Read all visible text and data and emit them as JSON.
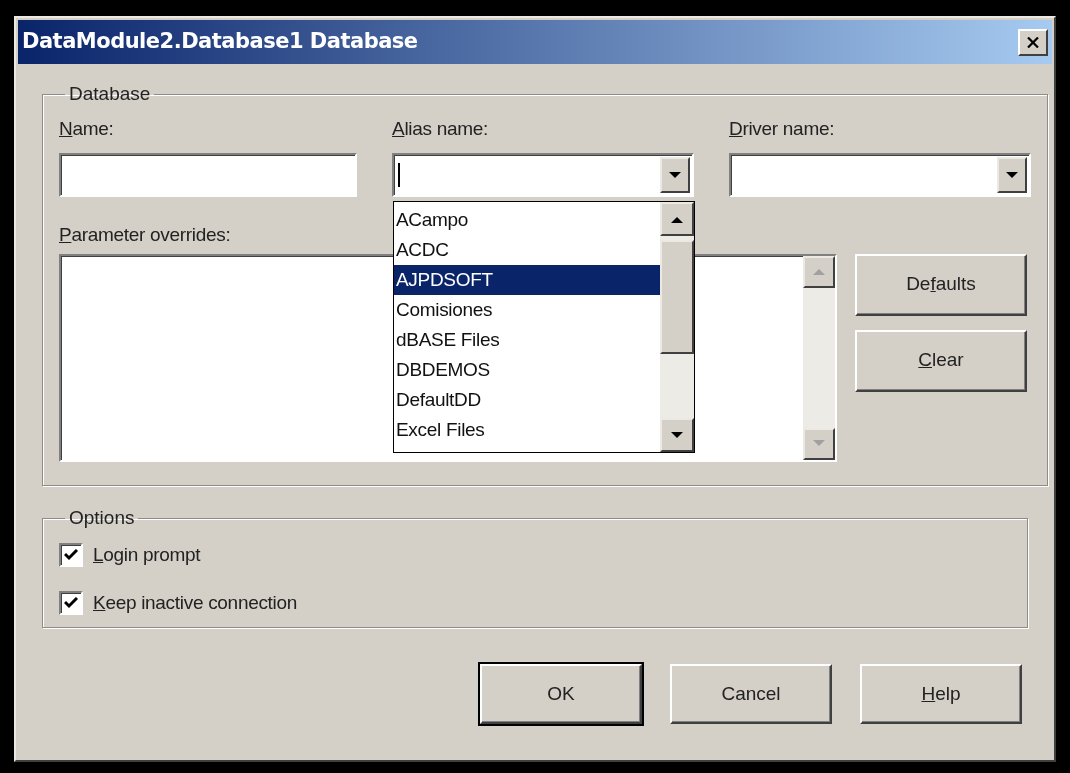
{
  "window": {
    "title": "DataModule2.Database1 Database"
  },
  "database": {
    "legend": "Database",
    "fields": [
      {
        "kind": "text",
        "label": {
          "key": "N",
          "after": "ame:"
        }
      },
      {
        "kind": "combo",
        "label": {
          "key": "A",
          "after": "lias name:"
        },
        "expanded": true
      },
      {
        "kind": "combo",
        "label": {
          "key": "D",
          "after": "river name:"
        }
      }
    ],
    "parameter_overrides": {
      "label": {
        "key": "P",
        "after": "arameter overrides:"
      }
    },
    "buttons": [
      {
        "label": {
          "before": "De",
          "key": "f",
          "after": "aults"
        }
      },
      {
        "label": {
          "key": "C",
          "after": "lear"
        }
      }
    ]
  },
  "alias_dropdown": {
    "items": [
      {
        "text": "ACampo",
        "selected": false
      },
      {
        "text": "ACDC",
        "selected": false
      },
      {
        "text": "AJPDSOFT",
        "selected": true
      },
      {
        "text": "Comisiones",
        "selected": false
      },
      {
        "text": "dBASE Files",
        "selected": false
      },
      {
        "text": "DBDEMOS",
        "selected": false
      },
      {
        "text": "DefaultDD",
        "selected": false
      },
      {
        "text": "Excel Files",
        "selected": false
      }
    ]
  },
  "options": {
    "legend": "Options",
    "checkboxes": [
      {
        "label": {
          "key": "L",
          "after": "ogin prompt"
        },
        "checked": true
      },
      {
        "label": {
          "key": "K",
          "after": "eep inactive connection"
        },
        "checked": true
      }
    ]
  },
  "buttons": [
    {
      "label": {
        "after": "OK"
      },
      "default": true
    },
    {
      "label": {
        "after": "Cancel"
      },
      "default": false
    },
    {
      "label": {
        "key": "H",
        "after": "elp"
      },
      "default": false
    }
  ]
}
